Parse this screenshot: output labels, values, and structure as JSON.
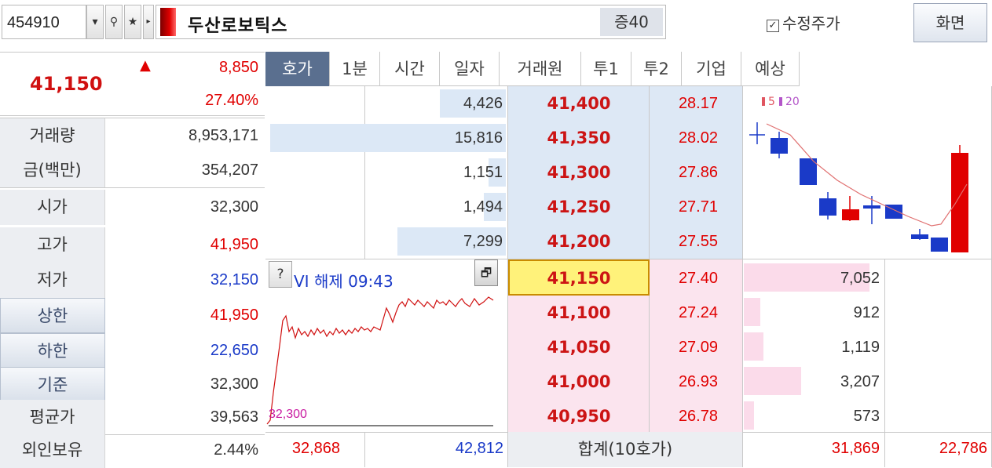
{
  "topbar": {
    "code": "454910",
    "stock_name": "두산로보틱스",
    "margin": "증40",
    "adjusted_price_label": "수정주가",
    "adjusted_price_checked": true,
    "screen_button": "화면"
  },
  "summary": {
    "price": "41,150",
    "change": "8,850",
    "change_pct": "27.40%",
    "direction": "up"
  },
  "info_rows": [
    {
      "label": "거래량",
      "value": "8,953,171",
      "color": "dark",
      "button": false
    },
    {
      "label": "금(백만)",
      "value": "354,207",
      "color": "dark",
      "button": false
    },
    {
      "label": "시가",
      "value": "32,300",
      "color": "dark",
      "button": false
    },
    {
      "label": "고가",
      "value": "41,950",
      "color": "red",
      "button": false
    },
    {
      "label": "저가",
      "value": "32,150",
      "color": "blue",
      "button": false
    },
    {
      "label": "상한",
      "value": "41,950",
      "color": "red",
      "button": true
    },
    {
      "label": "하한",
      "value": "22,650",
      "color": "blue",
      "button": true
    },
    {
      "label": "기준",
      "value": "32,300",
      "color": "dark",
      "button": true
    },
    {
      "label": "평균가",
      "value": "39,563",
      "color": "dark",
      "button": false
    },
    {
      "label": "외인보유",
      "value": "2.44%",
      "color": "dark",
      "button": false
    }
  ],
  "tabs": [
    {
      "label": "호가",
      "active": true
    },
    {
      "label": "1분",
      "active": false
    },
    {
      "label": "시간",
      "active": false
    },
    {
      "label": "일자",
      "active": false
    },
    {
      "label": "거래원",
      "active": false
    },
    {
      "label": "투1",
      "active": false
    },
    {
      "label": "투2",
      "active": false
    },
    {
      "label": "기업",
      "active": false
    },
    {
      "label": "예상",
      "active": false
    }
  ],
  "asks": [
    {
      "qty": "4,426",
      "qty_value": 4426,
      "price": "41,400",
      "pct": "28.17"
    },
    {
      "qty": "15,816",
      "qty_value": 15816,
      "price": "41,350",
      "pct": "28.02"
    },
    {
      "qty": "1,151",
      "qty_value": 1151,
      "price": "41,300",
      "pct": "27.86"
    },
    {
      "qty": "1,494",
      "qty_value": 1494,
      "price": "41,250",
      "pct": "27.71"
    },
    {
      "qty": "7,299",
      "qty_value": 7299,
      "price": "41,200",
      "pct": "27.55"
    }
  ],
  "bids": [
    {
      "qty": "7,052",
      "qty_value": 7052,
      "price": "41,150",
      "pct": "27.40",
      "current": true
    },
    {
      "qty": "912",
      "qty_value": 912,
      "price": "41,100",
      "pct": "27.24",
      "current": false
    },
    {
      "qty": "1,119",
      "qty_value": 1119,
      "price": "41,050",
      "pct": "27.09",
      "current": false
    },
    {
      "qty": "3,207",
      "qty_value": 3207,
      "price": "41,000",
      "pct": "26.93",
      "current": false
    },
    {
      "qty": "573",
      "qty_value": 573,
      "price": "40,950",
      "pct": "26.78",
      "current": false
    }
  ],
  "mini_chart": {
    "vi_text": "VI 해제 09:43",
    "base_label": "32,300",
    "help": "?",
    "restore": "🗗"
  },
  "candle_chart": {
    "legend_ma5": "5",
    "legend_ma20": "20"
  },
  "footer": {
    "left_a": "32,868",
    "left_b": "42,812",
    "sum_label": "합계(10호가)",
    "right_a": "31,869",
    "right_b": "22,786"
  },
  "colors": {
    "up": "#e00000",
    "down": "#1a3ac8",
    "ask_band": "#dde8f5",
    "bid_band": "#fbe4ee",
    "active_tab": "#5a6f8f"
  }
}
